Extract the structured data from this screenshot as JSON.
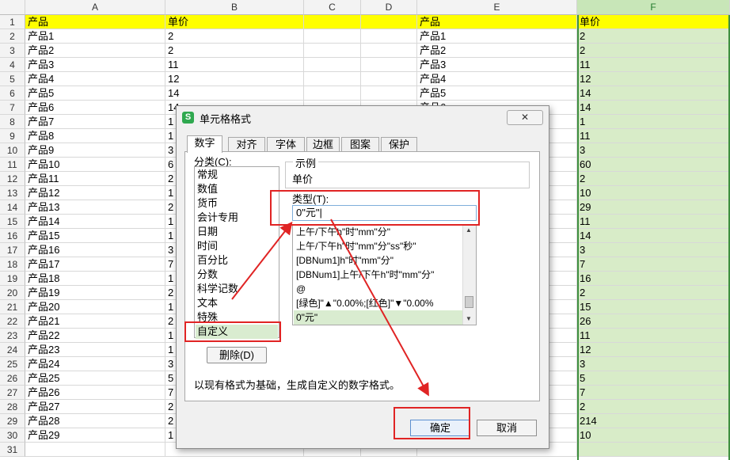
{
  "sheet": {
    "columns": [
      {
        "letter": "A",
        "selected": false
      },
      {
        "letter": "B",
        "selected": false
      },
      {
        "letter": "C",
        "selected": false
      },
      {
        "letter": "D",
        "selected": false
      },
      {
        "letter": "",
        "selected": false
      },
      {
        "letter": "E",
        "selected": false
      },
      {
        "letter": "F",
        "selected": true
      }
    ],
    "header_row": {
      "A": "产品",
      "B": "单价",
      "E": "产品",
      "F": "单价"
    },
    "rows": [
      {
        "num": "1"
      },
      {
        "num": "2"
      },
      {
        "num": "3"
      },
      {
        "num": "4"
      },
      {
        "num": "5"
      },
      {
        "num": "6"
      },
      {
        "num": "7"
      },
      {
        "num": "8"
      },
      {
        "num": "9"
      },
      {
        "num": "10"
      },
      {
        "num": "11"
      },
      {
        "num": "12"
      },
      {
        "num": "13"
      },
      {
        "num": "14"
      },
      {
        "num": "15"
      },
      {
        "num": "16"
      },
      {
        "num": "17"
      },
      {
        "num": "18"
      },
      {
        "num": "19"
      },
      {
        "num": "20"
      },
      {
        "num": "21"
      },
      {
        "num": "22"
      },
      {
        "num": "23"
      },
      {
        "num": "24"
      },
      {
        "num": "25"
      },
      {
        "num": "26"
      },
      {
        "num": "27"
      },
      {
        "num": "28"
      },
      {
        "num": "29"
      },
      {
        "num": "30"
      },
      {
        "num": "31"
      }
    ],
    "data": [
      {
        "A": "产品1",
        "B": "2",
        "E": "产品1",
        "F": "2"
      },
      {
        "A": "产品2",
        "B": "2",
        "E": "产品2",
        "F": "2"
      },
      {
        "A": "产品3",
        "B": "11",
        "E": "产品3",
        "F": "11"
      },
      {
        "A": "产品4",
        "B": "12",
        "E": "产品4",
        "F": "12"
      },
      {
        "A": "产品5",
        "B": "14",
        "E": "产品5",
        "F": "14"
      },
      {
        "A": "产品6",
        "B": "14",
        "E": "产品6",
        "F": "14"
      },
      {
        "A": "产品7",
        "B": "1",
        "E": "",
        "F": "1"
      },
      {
        "A": "产品8",
        "B": "1",
        "E": "",
        "F": "11"
      },
      {
        "A": "产品9",
        "B": "3",
        "E": "",
        "F": "3"
      },
      {
        "A": "产品10",
        "B": "6",
        "E": "",
        "F": "60"
      },
      {
        "A": "产品11",
        "B": "2",
        "E": "",
        "F": "2"
      },
      {
        "A": "产品12",
        "B": "1",
        "E": "",
        "F": "10"
      },
      {
        "A": "产品13",
        "B": "2",
        "E": "",
        "F": "29"
      },
      {
        "A": "产品14",
        "B": "1",
        "E": "",
        "F": "11"
      },
      {
        "A": "产品15",
        "B": "1",
        "E": "",
        "F": "14"
      },
      {
        "A": "产品16",
        "B": "3",
        "E": "",
        "F": "3"
      },
      {
        "A": "产品17",
        "B": "7",
        "E": "",
        "F": "7"
      },
      {
        "A": "产品18",
        "B": "1",
        "E": "",
        "F": "16"
      },
      {
        "A": "产品19",
        "B": "2",
        "E": "",
        "F": "2"
      },
      {
        "A": "产品20",
        "B": "1",
        "E": "",
        "F": "15"
      },
      {
        "A": "产品21",
        "B": "2",
        "E": "",
        "F": "26"
      },
      {
        "A": "产品22",
        "B": "1",
        "E": "",
        "F": "11"
      },
      {
        "A": "产品23",
        "B": "1",
        "E": "",
        "F": "12"
      },
      {
        "A": "产品24",
        "B": "3",
        "E": "",
        "F": "3"
      },
      {
        "A": "产品25",
        "B": "5",
        "E": "",
        "F": "5"
      },
      {
        "A": "产品26",
        "B": "7",
        "E": "",
        "F": "7"
      },
      {
        "A": "产品27",
        "B": "2",
        "E": "",
        "F": "2"
      },
      {
        "A": "产品28",
        "B": "2",
        "E": "",
        "F": "214"
      },
      {
        "A": "产品29",
        "B": "1",
        "E": "",
        "F": "10"
      },
      {
        "A": "",
        "B": "",
        "E": "",
        "F": ""
      }
    ]
  },
  "dialog": {
    "title": "单元格格式",
    "app_icon_letter": "S",
    "close_label": "✕",
    "tabs": [
      {
        "label": "数字",
        "active": true
      },
      {
        "label": "对齐",
        "active": false
      },
      {
        "label": "字体",
        "active": false
      },
      {
        "label": "边框",
        "active": false
      },
      {
        "label": "图案",
        "active": false
      },
      {
        "label": "保护",
        "active": false
      }
    ],
    "category_label": "分类(C):",
    "categories": [
      {
        "label": "常规",
        "selected": false
      },
      {
        "label": "数值",
        "selected": false
      },
      {
        "label": "货币",
        "selected": false
      },
      {
        "label": "会计专用",
        "selected": false
      },
      {
        "label": "日期",
        "selected": false
      },
      {
        "label": "时间",
        "selected": false
      },
      {
        "label": "百分比",
        "selected": false
      },
      {
        "label": "分数",
        "selected": false
      },
      {
        "label": "科学记数",
        "selected": false
      },
      {
        "label": "文本",
        "selected": false
      },
      {
        "label": "特殊",
        "selected": false
      },
      {
        "label": "自定义",
        "selected": true
      }
    ],
    "delete_label": "删除(D)",
    "sample_label": "示例",
    "sample_value": "单价",
    "type_label": "类型(T):",
    "type_value": "0\"元\"|",
    "format_items": [
      {
        "label": "上午/下午h\"时\"mm\"分\"",
        "selected": false
      },
      {
        "label": "上午/下午h\"时\"mm\"分\"ss\"秒\"",
        "selected": false
      },
      {
        "label": "[DBNum1]h\"时\"mm\"分\"",
        "selected": false
      },
      {
        "label": "[DBNum1]上午/下午h\"时\"mm\"分\"",
        "selected": false
      },
      {
        "label": "@",
        "selected": false
      },
      {
        "label": "[绿色]\"▲\"0.00%;[红色]\"▼\"0.00%",
        "selected": false
      },
      {
        "label": "0\"元\"",
        "selected": true
      }
    ],
    "description": "以现有格式为基础，生成自定义的数字格式。",
    "ok_label": "确定",
    "cancel_label": "取消"
  },
  "colors": {
    "header_fill": "#ffff00",
    "selected_column_fill": "#d8ecc8",
    "annotation": "#e02424"
  }
}
